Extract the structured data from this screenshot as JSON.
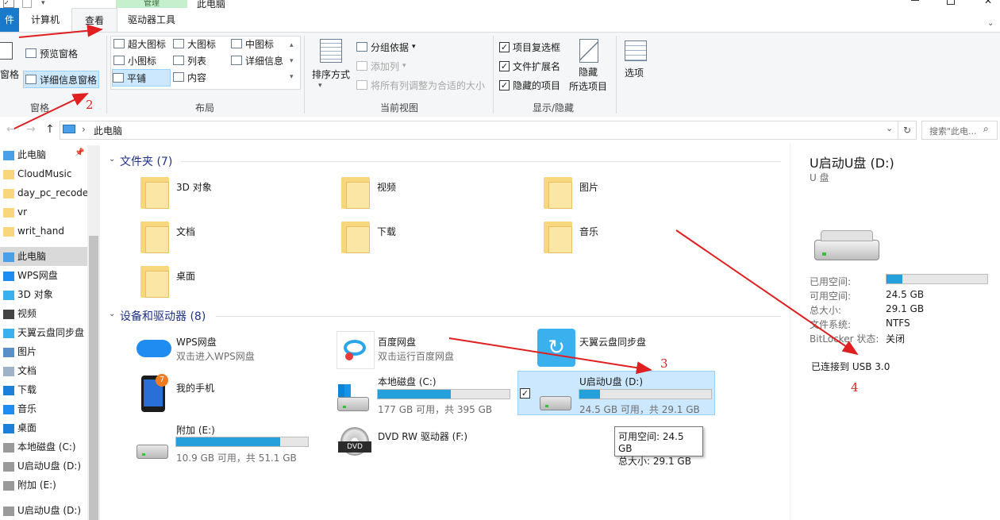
{
  "window": {
    "title": "此电脑"
  },
  "tabs": {
    "file": "件",
    "computer": "计算机",
    "view": "查看",
    "drive_tools": "驱动器工具",
    "manage": "管理"
  },
  "ribbon": {
    "panes": {
      "label": "窗格",
      "nav_pane": "窗格",
      "preview": "预览窗格",
      "details": "详细信息窗格"
    },
    "layout": {
      "label": "布局",
      "xl": "超大图标",
      "large": "大图标",
      "medium": "中图标",
      "small": "小图标",
      "list": "列表",
      "details": "详细信息",
      "tiles": "平铺",
      "content": "内容"
    },
    "current_view": {
      "label": "当前视图",
      "sort": "排序方式",
      "group": "分组依据",
      "add_col": "添加列",
      "fit_cols": "将所有列调整为合适的大小"
    },
    "show_hide": {
      "label": "显示/隐藏",
      "item_check": "项目复选框",
      "ext": "文件扩展名",
      "hidden": "隐藏的项目",
      "hide": "隐藏",
      "hide2": "所选项目",
      "options": "选项"
    }
  },
  "address": {
    "path": "此电脑",
    "search_placeholder": "搜索\"此电..."
  },
  "nav": [
    {
      "label": "此电脑",
      "icon": "pc-icon"
    },
    {
      "label": "CloudMusic",
      "icon": "folder-icon"
    },
    {
      "label": "day_pc_recode",
      "icon": "folder-icon"
    },
    {
      "label": "vr",
      "icon": "folder-icon"
    },
    {
      "label": "writ_hand",
      "icon": "folder-icon"
    },
    {
      "label": "此电脑",
      "icon": "pc-icon"
    },
    {
      "label": "WPS网盘",
      "icon": "cloud-icon"
    },
    {
      "label": "3D 对象",
      "icon": "cube-icon"
    },
    {
      "label": "视频",
      "icon": "video-icon"
    },
    {
      "label": "天翼云盘同步盘",
      "icon": "sync-icon"
    },
    {
      "label": "图片",
      "icon": "picture-icon"
    },
    {
      "label": "文档",
      "icon": "document-icon"
    },
    {
      "label": "下载",
      "icon": "download-icon"
    },
    {
      "label": "音乐",
      "icon": "music-icon"
    },
    {
      "label": "桌面",
      "icon": "desktop-icon"
    },
    {
      "label": "本地磁盘 (C:)",
      "icon": "drive-icon"
    },
    {
      "label": "U启动U盘 (D:)",
      "icon": "usb-drive-icon"
    },
    {
      "label": "附加 (E:)",
      "icon": "drive-icon"
    },
    {
      "label": "U启动U盘 (D:)",
      "icon": "usb-drive-icon"
    }
  ],
  "folders_section": {
    "title": "文件夹 (7)"
  },
  "folders": [
    "3D 对象",
    "视频",
    "图片",
    "文档",
    "下载",
    "音乐",
    "桌面"
  ],
  "devices_section": {
    "title": "设备和驱动器 (8)"
  },
  "devices": {
    "wps": {
      "name": "WPS网盘",
      "sub": "双击进入WPS网盘"
    },
    "baidu": {
      "name": "百度网盘",
      "sub": "双击运行百度网盘"
    },
    "tianyi": {
      "name": "天翼云盘同步盘"
    },
    "phone": {
      "name": "我的手机",
      "badge": "7"
    },
    "c": {
      "name": "本地磁盘 (C:)",
      "sub": "177 GB 可用，共 395 GB",
      "used": 0.552
    },
    "d": {
      "name": "U启动U盘 (D:)",
      "sub": "24.5 GB 可用，共 29.1 GB",
      "used": 0.158
    },
    "e": {
      "name": "附加 (E:)",
      "sub": "10.9 GB 可用，共 51.1 GB",
      "used": 0.787
    },
    "dvd": {
      "name": "DVD RW 驱动器 (F:)",
      "label": "DVD"
    }
  },
  "tooltip": {
    "line1": "可用空间: 24.5 GB",
    "line2": "总大小: 29.1 GB"
  },
  "details": {
    "title": "U启动U盘 (D:)",
    "type": "U 盘",
    "used_label": "已用空间:",
    "free_label": "可用空间:",
    "free": "24.5 GB",
    "total_label": "总大小:",
    "total": "29.1 GB",
    "fs_label": "文件系统:",
    "fs": "NTFS",
    "bitlocker_label": "BitLocker 状态:",
    "bitlocker": "关闭",
    "connected": "已连接到 USB 3.0",
    "used": 0.158
  },
  "annotations": [
    "2",
    "3",
    "4"
  ],
  "colors": {
    "accent": "#26a0da",
    "file_tab": "#1979ca",
    "arrow": "#e02020",
    "selection": "#cce8ff"
  }
}
